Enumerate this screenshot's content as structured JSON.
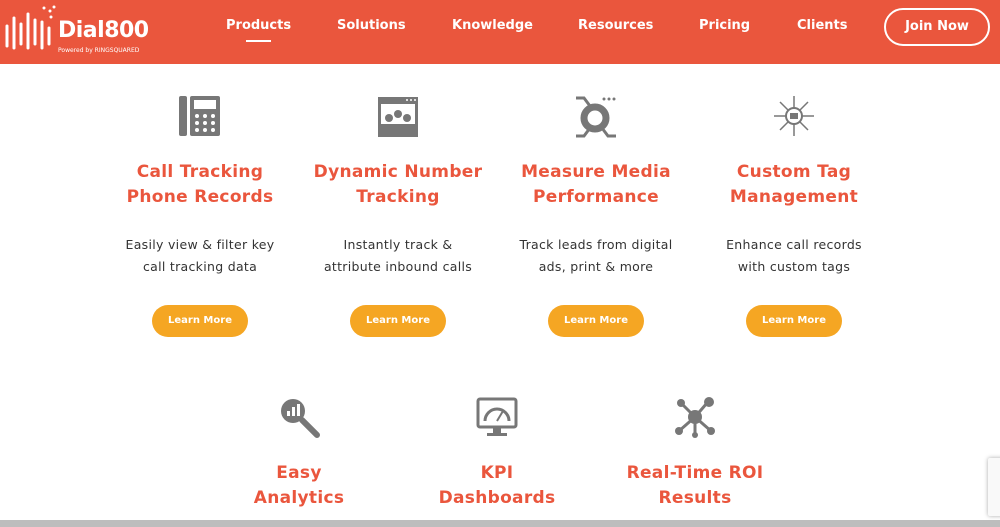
{
  "brand": {
    "name": "Dial800",
    "powered_by": "Powered by RINGSQUARED"
  },
  "nav": {
    "items": [
      "Products",
      "Solutions",
      "Knowledge",
      "Resources",
      "Pricing",
      "Clients"
    ],
    "active": "Products",
    "cta": "Join Now"
  },
  "colors": {
    "brand": "#ea563d",
    "button": "#f5a623",
    "icon": "#777777"
  },
  "cards": [
    {
      "icon": "desk-phone-icon",
      "title1": "Call Tracking",
      "title2": "Phone Records",
      "desc1": "Easily view & filter key",
      "desc2": "call tracking data",
      "button": "Learn More"
    },
    {
      "icon": "audience-screen-icon",
      "title1": "Dynamic Number",
      "title2": "Tracking",
      "desc1": "Instantly track &",
      "desc2": "attribute inbound calls",
      "button": "Learn More"
    },
    {
      "icon": "pie-chart-icon",
      "title1": "Measure Media",
      "title2": "Performance",
      "desc1": "Track leads from digital",
      "desc2": "ads, print & more",
      "button": "Learn More"
    },
    {
      "icon": "megaphone-network-icon",
      "title1": "Custom Tag",
      "title2": "Management",
      "desc1": "Enhance call records",
      "desc2": "with custom tags",
      "button": "Learn More"
    },
    {
      "icon": "magnifier-chart-icon",
      "title1": "Easy",
      "title2": "Analytics"
    },
    {
      "icon": "dashboard-monitor-icon",
      "title1": "KPI",
      "title2": "Dashboards"
    },
    {
      "icon": "network-nodes-icon",
      "title1": "Real-Time ROI",
      "title2": "Results"
    }
  ]
}
